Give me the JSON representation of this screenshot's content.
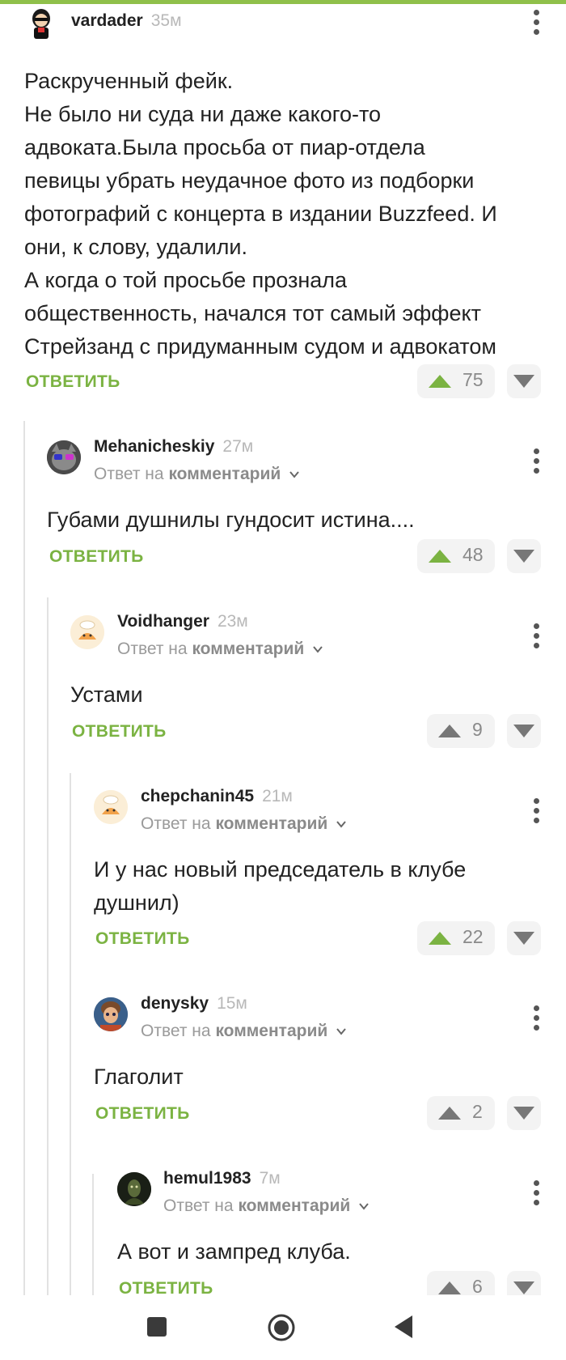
{
  "reply_label": "ОТВЕТИТЬ",
  "reply_to_prefix": "Ответ на",
  "reply_to_target": "комментарий",
  "colors": {
    "accent_green": "#7bb342",
    "top_bar": "#8fc04a",
    "muted": "#9a9a9a"
  },
  "comments": [
    {
      "username": "vardader",
      "time": "35м",
      "lines": [
        "Раскрученный фейк.",
        "Не было ни суда ни даже какого-то",
        "адвоката.Была просьба от пиар-отдела",
        "певицы убрать неудачное фото из подборки",
        "фотографий с концерта в издании Buzzfeed. И",
        "они, к слову, удалили.",
        "А когда о той просьбе прознала",
        "общественность, начался тот самый эффект",
        "Стрейзанд с придуманным судом и адвокатом"
      ],
      "rating": "75",
      "rating_positive": true
    },
    {
      "username": "Mehanicheskiy",
      "time": "27м",
      "lines": [
        "Губами душнилы гундосит истина...."
      ],
      "rating": "48",
      "rating_positive": true
    },
    {
      "username": "Voidhanger",
      "time": "23м",
      "lines": [
        "Устами"
      ],
      "rating": "9",
      "rating_positive": false
    },
    {
      "username": "chepchanin45",
      "time": "21м",
      "lines": [
        "И у нас новый председатель в клубе",
        "душнил)"
      ],
      "rating": "22",
      "rating_positive": true
    },
    {
      "username": "denysky",
      "time": "15м",
      "lines": [
        "Глаголит"
      ],
      "rating": "2",
      "rating_positive": false
    },
    {
      "username": "hemul1983",
      "time": "7м",
      "lines": [
        "А вот и зампред клуба."
      ],
      "rating": "6",
      "rating_positive": false
    }
  ],
  "navbar": {
    "icons": [
      "recent-apps-icon",
      "home-icon",
      "back-icon"
    ]
  }
}
